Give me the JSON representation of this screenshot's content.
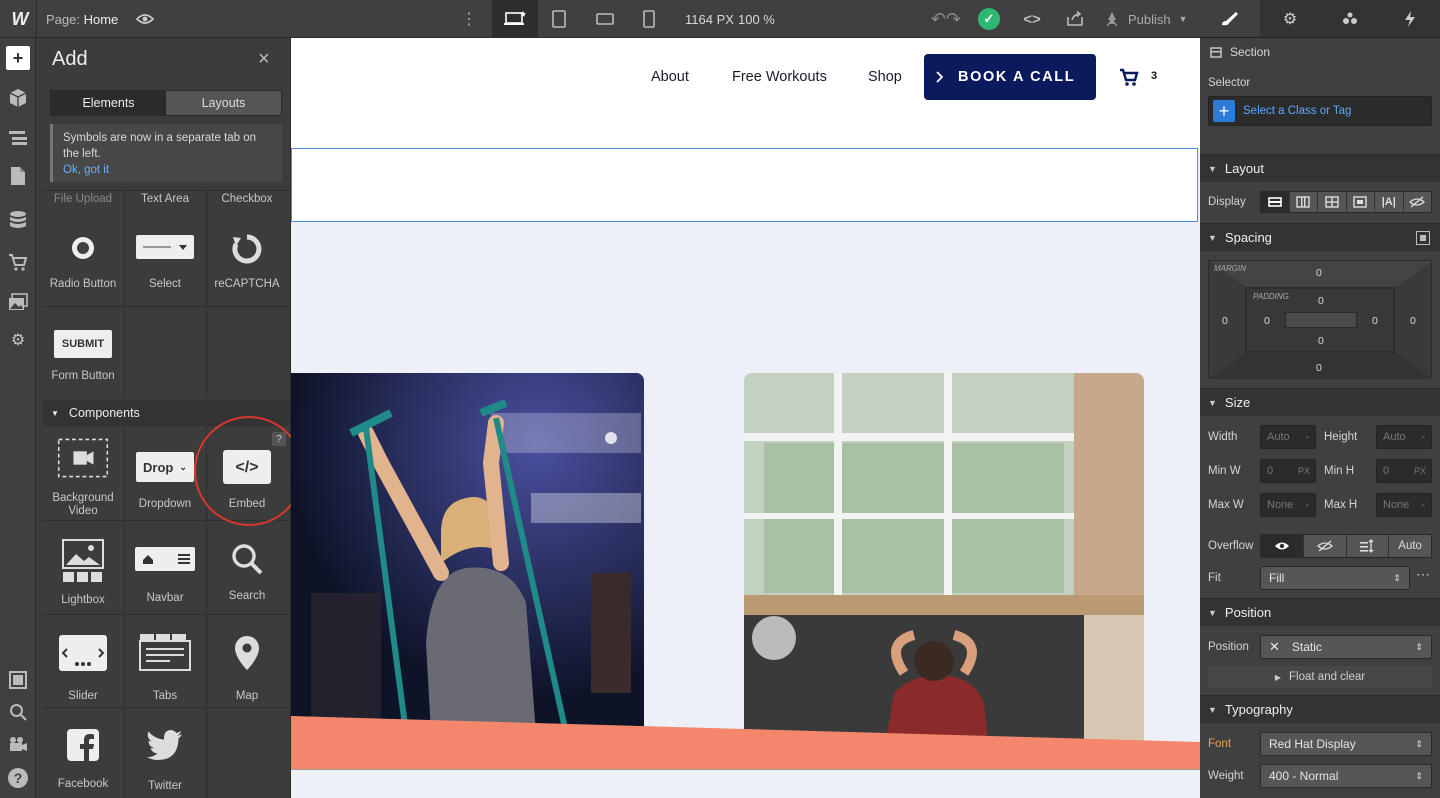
{
  "topbar": {
    "page_prefix": "Page:",
    "page_name": "Home",
    "canvas_width": "1164 PX",
    "zoom": "100 %",
    "publish_label": "Publish"
  },
  "add_panel": {
    "title": "Add",
    "tabs": [
      "Elements",
      "Layouts"
    ],
    "notice_text": "Symbols are now in a separate tab on the left.",
    "notice_link": "Ok, got it",
    "forms_row_labels": [
      "File Upload",
      "Text Area",
      "Checkbox"
    ],
    "form_items": [
      {
        "label": "Radio Button",
        "icon": "radio-button-icon"
      },
      {
        "label": "Select",
        "icon": "select-icon"
      },
      {
        "label": "reCAPTCHA",
        "icon": "recaptcha-icon"
      },
      {
        "label": "Form Button",
        "icon": "form-button-icon"
      }
    ],
    "submit_text": "SUBMIT",
    "components_header": "Components",
    "dropdown_icon_text": "Drop",
    "help_mark": "?",
    "components": [
      {
        "label": "Background Video",
        "icon": "background-video-icon"
      },
      {
        "label": "Dropdown",
        "icon": "dropdown-icon"
      },
      {
        "label": "Embed",
        "icon": "embed-icon"
      },
      {
        "label": "Lightbox",
        "icon": "lightbox-icon"
      },
      {
        "label": "Navbar",
        "icon": "navbar-icon"
      },
      {
        "label": "Search",
        "icon": "search-icon"
      },
      {
        "label": "Slider",
        "icon": "slider-icon"
      },
      {
        "label": "Tabs",
        "icon": "tabs-icon"
      },
      {
        "label": "Map",
        "icon": "map-pin-icon"
      },
      {
        "label": "Facebook",
        "icon": "facebook-icon"
      },
      {
        "label": "Twitter",
        "icon": "twitter-icon"
      }
    ]
  },
  "site": {
    "nav": [
      "About",
      "Free Workouts",
      "Shop"
    ],
    "cta": "BOOK A CALL",
    "cart_count": "3",
    "colors": {
      "navy": "#0a1a5c",
      "coral": "#f4876b",
      "page_bg": "#eef0f7",
      "selection": "#4a90e2"
    }
  },
  "style_panel": {
    "element_type": "Section",
    "selector_label": "Selector",
    "selector_placeholder": "Select a Class or Tag",
    "layout": {
      "title": "Layout",
      "display_label": "Display"
    },
    "spacing": {
      "title": "Spacing",
      "margin_label": "MARGIN",
      "padding_label": "PADDING",
      "margin": [
        "0",
        "0",
        "0",
        "0"
      ],
      "padding": [
        "0",
        "0",
        "0",
        "0"
      ]
    },
    "size": {
      "title": "Size",
      "width_label": "Width",
      "width_value": "Auto",
      "height_label": "Height",
      "height_value": "Auto",
      "minw_label": "Min W",
      "minw_value": "0",
      "minw_unit": "PX",
      "minh_label": "Min H",
      "minh_value": "0",
      "minh_unit": "PX",
      "maxw_label": "Max W",
      "maxw_value": "None",
      "maxh_label": "Max H",
      "maxh_value": "None",
      "unit_dash": "-",
      "overflow_label": "Overflow",
      "overflow_auto": "Auto",
      "fit_label": "Fit",
      "fit_value": "Fill"
    },
    "position": {
      "title": "Position",
      "label": "Position",
      "value": "Static",
      "float_label": "Float and clear"
    },
    "typography": {
      "title": "Typography",
      "font_label": "Font",
      "font_value": "Red Hat Display",
      "weight_label": "Weight",
      "weight_value": "400 - Normal"
    }
  }
}
